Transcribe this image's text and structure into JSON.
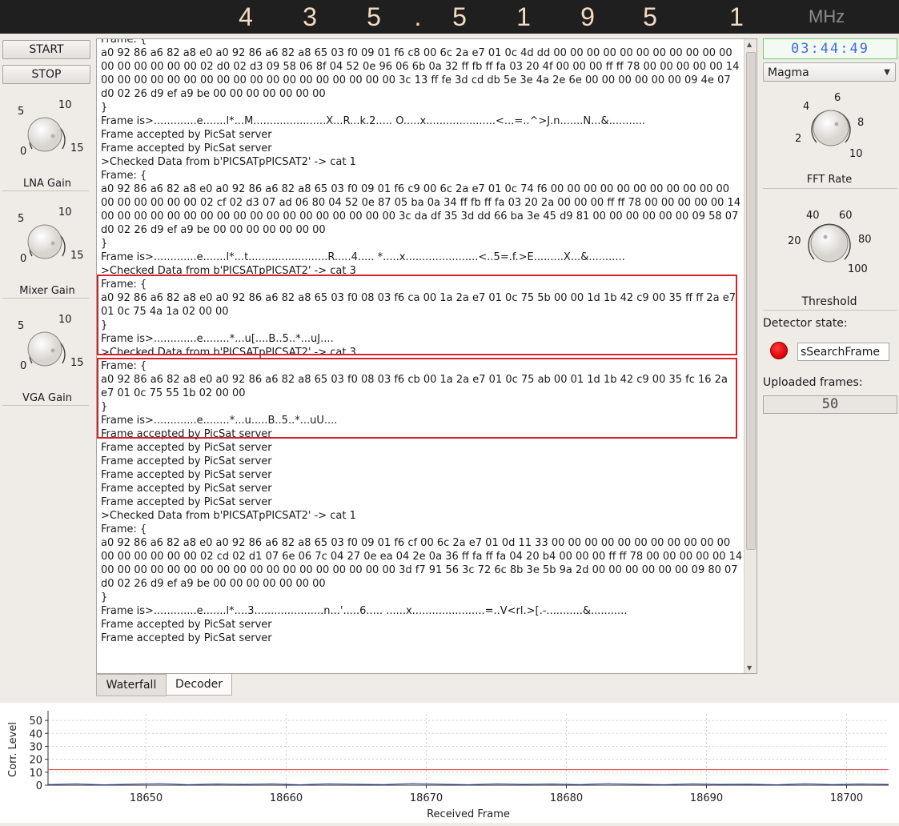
{
  "frequency": {
    "digits": [
      "4",
      "3",
      "5",
      ".",
      "5",
      "1",
      "9",
      "5",
      "1"
    ],
    "unit": "MHz"
  },
  "controls": {
    "start_label": "START",
    "stop_label": "STOP"
  },
  "knobs": {
    "lna": {
      "label": "LNA Gain",
      "scale": [
        "5",
        "10",
        "0",
        "15"
      ]
    },
    "mixer": {
      "label": "Mixer Gain",
      "scale": [
        "5",
        "10",
        "0",
        "15"
      ]
    },
    "vga": {
      "label": "VGA Gain",
      "scale": [
        "5",
        "10",
        "0",
        "15"
      ]
    },
    "fft": {
      "label": "FFT Rate",
      "scale": [
        "4",
        "6",
        "8",
        "2",
        "10"
      ]
    },
    "threshold": {
      "label": "Threshold",
      "scale": [
        "40",
        "60",
        "20",
        "80",
        "100"
      ]
    }
  },
  "right_panel": {
    "clock": "03:44:49",
    "colormap": "Magma",
    "detector_state_label": "Detector state:",
    "detector_state_value": "sSearchFrame",
    "uploaded_frames_label": "Uploaded frames:",
    "uploaded_frames_count": "50"
  },
  "tabs": [
    {
      "label": "Waterfall"
    },
    {
      "label": "Decoder"
    }
  ],
  "log_lines": [
    "Frame: {",
    "a0 92 86 a6 82 a8 e0 a0 92 86 a6 82 a8 65 03 f0 09 01 f6 c8 00 6c 2a e7 01 0c 4d dd 00 00 00 00 00 00 00 00 00 00 00 00 00 00 00 00 00 02 d0 02 d3 09 58 06 8f 04 52 0e 96 06 6b 0a 32 ff fb ff fa 03 20 4f 00 00 00 ff ff 78 00 00 00 00 00 14 00 00 00 00 00 00 00 00 00 00 00 00 00 00 00 00 00 00 3c 13 ff fe 3d cd db 5e 3e 4a 2e 6e 00 00 00 00 00 00 09 4e 07 d0 02 26 d9 ef a9 be 00 00 00 00 00 00 00",
    "}",
    "Frame is>.............e.......l*...M......................X...R...k.2..... O.....x.....................<...=..^>J.n.......N...&...........",
    "Frame accepted by PicSat server",
    "Frame accepted by PicSat server",
    ">Checked Data from b'PICSATpPICSAT2' -> cat 1",
    "Frame: {",
    "a0 92 86 a6 82 a8 e0 a0 92 86 a6 82 a8 65 03 f0 09 01 f6 c9 00 6c 2a e7 01 0c 74 f6 00 00 00 00 00 00 00 00 00 00 00 00 00 00 00 00 00 02 cf 02 d3 07 ad 06 80 04 52 0e 87 05 ba 0a 34 ff fb ff fa 03 20 2a 00 00 00 ff ff 78 00 00 00 00 00 14 00 00 00 00 00 00 00 00 00 00 00 00 00 00 00 00 00 00 3c da df 35 3d dd 66 ba 3e 45 d9 81 00 00 00 00 00 00 09 58 07 d0 02 26 d9 ef a9 be 00 00 00 00 00 00 00",
    "}",
    "Frame is>.............e.......l*...t........................R.....4..... *.....x......................<..5=.f.>E.........X...&...........",
    ">Checked Data from b'PICSATpPICSAT2' -> cat 3",
    "Frame: {",
    "a0 92 86 a6 82 a8 e0 a0 92 86 a6 82 a8 65 03 f0 08 03 f6 ca 00 1a 2a e7 01 0c 75 5b 00 00 1d 1b 42 c9 00 35 ff ff 2a e7 01 0c 75 4a 1a 02 00 00",
    "}",
    "Frame is>.............e........*...u[....B..5..*...uJ....",
    ">Checked Data from b'PICSATpPICSAT2' -> cat 3",
    "Frame: {",
    "a0 92 86 a6 82 a8 e0 a0 92 86 a6 82 a8 65 03 f0 08 03 f6 cb 00 1a 2a e7 01 0c 75 ab 00 01 1d 1b 42 c9 00 35 fc 16 2a e7 01 0c 75 55 1b 02 00 00",
    "}",
    "Frame is>.............e........*...u.....B..5..*...uU....",
    "Frame accepted by PicSat server",
    "Frame accepted by PicSat server",
    "Frame accepted by PicSat server",
    "Frame accepted by PicSat server",
    "Frame accepted by PicSat server",
    "Frame accepted by PicSat server",
    ">Checked Data from b'PICSATpPICSAT2' -> cat 1",
    "Frame: {",
    "a0 92 86 a6 82 a8 e0 a0 92 86 a6 82 a8 65 03 f0 09 01 f6 cf 00 6c 2a e7 01 0d 11 33 00 00 00 00 00 00 00 00 00 00 00 00 00 00 00 00 00 02 cd 02 d1 07 6e 06 7c 04 27 0e ea 04 2e 0a 36 ff fa ff fa 04 20 b4 00 00 00 ff ff 78 00 00 00 00 00 14 00 00 00 00 00 00 00 00 00 00 00 00 00 00 00 00 00 00 3d f7 91 56 3c 72 6c 8b 3e 5b 9a 2d 00 00 00 00 00 00 09 80 07 d0 02 26 d9 ef a9 be 00 00 00 00 00 00 00",
    "}",
    "Frame is>.............e.......l*....3.....................n...'.....6..... ......x......................=..V<rl.>[.-...........&...........",
    "Frame accepted by PicSat server",
    "Frame accepted by PicSat server"
  ],
  "chart_data": {
    "type": "line",
    "title": "",
    "xlabel": "Received Frame",
    "ylabel": "Corr. Level",
    "xlim": [
      18643,
      18703
    ],
    "ylim": [
      0,
      55
    ],
    "x_ticks": [
      "18650",
      "18660",
      "18670",
      "18680",
      "18690",
      "18700"
    ],
    "y_ticks": [
      "0",
      "10",
      "20",
      "30",
      "40",
      "50"
    ],
    "grid": true,
    "threshold_line": {
      "value": 12,
      "color": "#d63a3a"
    },
    "series": [
      {
        "color": "#2b3d99",
        "x": [
          18643,
          18645,
          18647,
          18649,
          18651,
          18653,
          18655,
          18657,
          18659,
          18661,
          18663,
          18665,
          18667,
          18669,
          18671,
          18673,
          18675,
          18677,
          18679,
          18681,
          18683,
          18685,
          18687,
          18689,
          18691,
          18693,
          18695,
          18697,
          18699,
          18701,
          18703
        ],
        "values": [
          0.5,
          1,
          0.3,
          0.8,
          1.2,
          0.4,
          0.9,
          0.6,
          1,
          0.3,
          1.1,
          0.7,
          0.5,
          1.3,
          0.8,
          0.4,
          1,
          0.6,
          0.9,
          0.5,
          1.2,
          0.7,
          0.4,
          1,
          0.6,
          0.8,
          0.3,
          1.1,
          0.5,
          0.9,
          0.6
        ]
      }
    ]
  }
}
